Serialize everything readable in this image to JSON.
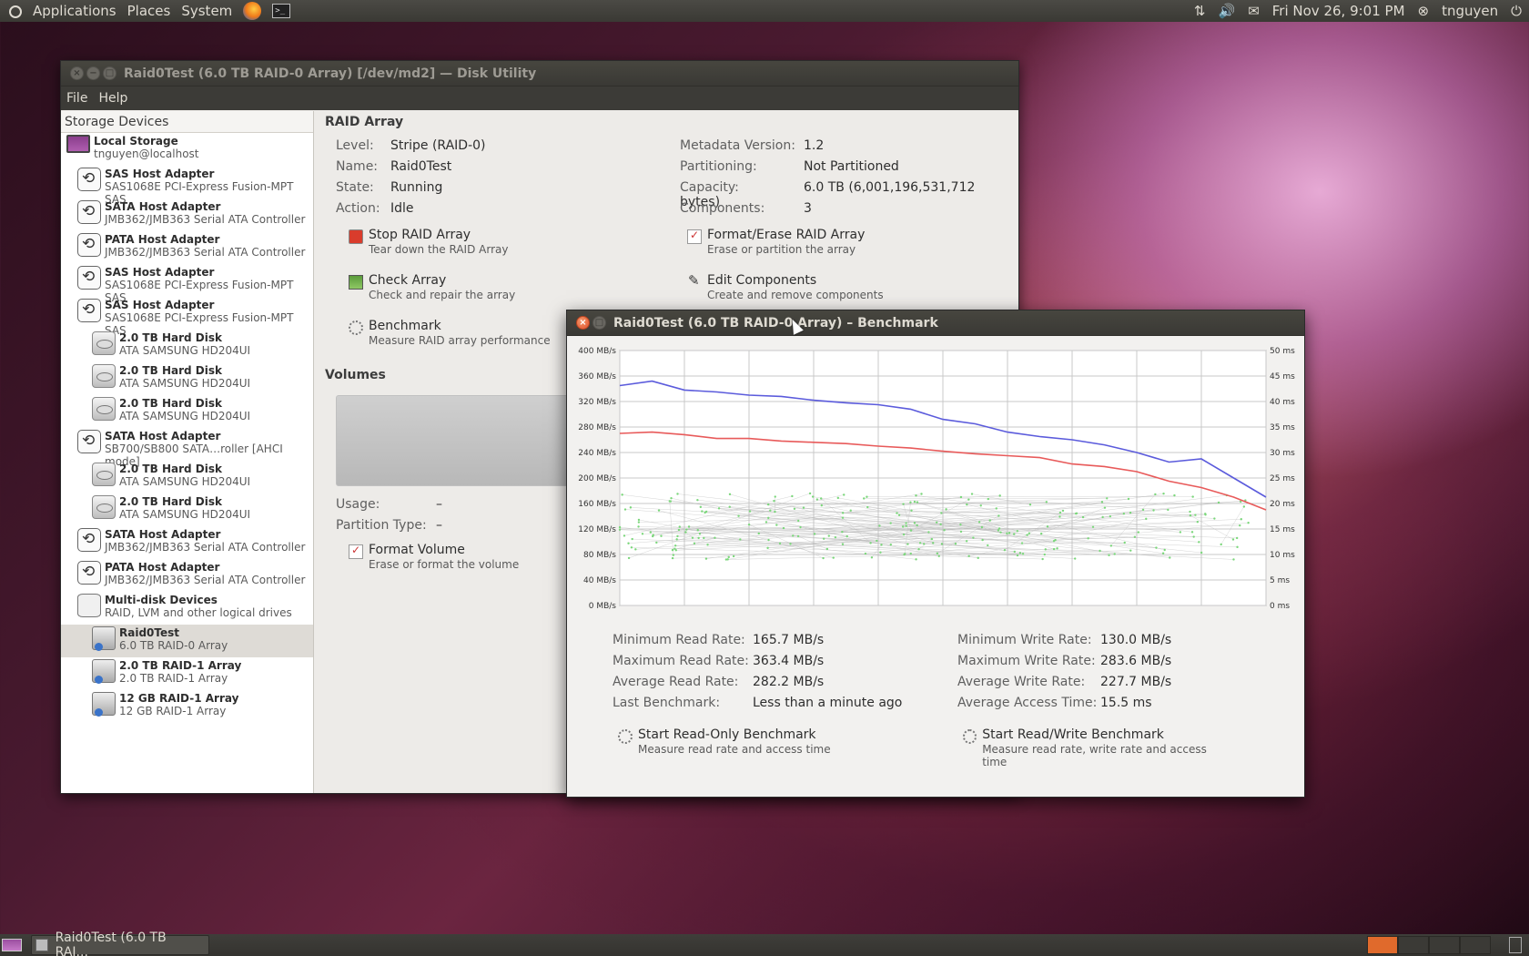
{
  "top_panel": {
    "menus": [
      "Applications",
      "Places",
      "System"
    ],
    "datetime": "Fri Nov 26,  9:01 PM",
    "user": "tnguyen"
  },
  "main_window": {
    "title": "Raid0Test (6.0 TB RAID-0 Array) [/dev/md2] — Disk Utility",
    "menu": [
      "File",
      "Help"
    ],
    "sidebar": {
      "header": "Storage Devices",
      "items": [
        {
          "title": "Local Storage",
          "sub": "tnguyen@localhost",
          "icon": "computer-icon"
        },
        {
          "title": "SAS Host Adapter",
          "sub": "SAS1068E PCI-Express Fusion-MPT SAS",
          "icon": "adapter-icon"
        },
        {
          "title": "SATA Host Adapter",
          "sub": "JMB362/JMB363 Serial ATA Controller",
          "icon": "adapter-icon"
        },
        {
          "title": "PATA Host Adapter",
          "sub": "JMB362/JMB363 Serial ATA Controller",
          "icon": "adapter-icon"
        },
        {
          "title": "SAS Host Adapter",
          "sub": "SAS1068E PCI-Express Fusion-MPT SAS",
          "icon": "adapter-icon"
        },
        {
          "title": "SAS Host Adapter",
          "sub": "SAS1068E PCI-Express Fusion-MPT SAS",
          "icon": "adapter-icon"
        },
        {
          "title": "2.0 TB Hard Disk",
          "sub": "ATA SAMSUNG HD204UI",
          "icon": "disk-icon"
        },
        {
          "title": "2.0 TB Hard Disk",
          "sub": "ATA SAMSUNG HD204UI",
          "icon": "disk-icon"
        },
        {
          "title": "2.0 TB Hard Disk",
          "sub": "ATA SAMSUNG HD204UI",
          "icon": "disk-icon"
        },
        {
          "title": "SATA Host Adapter",
          "sub": "SB700/SB800 SATA…roller [AHCI mode]",
          "icon": "adapter-icon"
        },
        {
          "title": "2.0 TB Hard Disk",
          "sub": "ATA SAMSUNG HD204UI",
          "icon": "disk-icon"
        },
        {
          "title": "2.0 TB Hard Disk",
          "sub": "ATA SAMSUNG HD204UI",
          "icon": "disk-icon"
        },
        {
          "title": "SATA Host Adapter",
          "sub": "JMB362/JMB363 Serial ATA Controller",
          "icon": "adapter-icon"
        },
        {
          "title": "PATA Host Adapter",
          "sub": "JMB362/JMB363 Serial ATA Controller",
          "icon": "adapter-icon"
        },
        {
          "title": "Multi-disk Devices",
          "sub": "RAID, LVM and other logical drives",
          "icon": "multi-disk-icon"
        },
        {
          "title": "Raid0Test",
          "sub": "6.0 TB RAID-0 Array",
          "icon": "raid-icon"
        },
        {
          "title": "2.0 TB RAID-1 Array",
          "sub": "2.0 TB RAID-1 Array",
          "icon": "raid-icon"
        },
        {
          "title": "12 GB RAID-1 Array",
          "sub": "12 GB RAID-1 Array",
          "icon": "raid-icon"
        }
      ],
      "selected": "Raid0Test"
    },
    "raid": {
      "section_title": "RAID Array",
      "fields_left": [
        {
          "k": "Level:",
          "v": "Stripe (RAID-0)"
        },
        {
          "k": "Name:",
          "v": "Raid0Test"
        },
        {
          "k": "State:",
          "v": "Running"
        },
        {
          "k": "Action:",
          "v": "Idle"
        }
      ],
      "fields_right": [
        {
          "k": "Metadata Version:",
          "v": "1.2"
        },
        {
          "k": "Partitioning:",
          "v": "Not Partitioned"
        },
        {
          "k": "Capacity:",
          "v": "6.0 TB (6,001,196,531,712 bytes)"
        },
        {
          "k": "Components:",
          "v": "3"
        }
      ],
      "actions": {
        "stop": {
          "title": "Stop RAID Array",
          "sub": "Tear down the RAID Array"
        },
        "format": {
          "title": "Format/Erase RAID Array",
          "sub": "Erase or partition the array"
        },
        "check": {
          "title": "Check Array",
          "sub": "Check and repair the array"
        },
        "edit": {
          "title": "Edit Components",
          "sub": "Create and remove components"
        },
        "benchmark": {
          "title": "Benchmark",
          "sub": "Measure RAID array performance"
        }
      }
    },
    "volumes": {
      "section_title": "Volumes",
      "usage_label": "Usage:",
      "usage_value": "–",
      "ptype_label": "Partition Type:",
      "ptype_value": "–",
      "format_title": "Format Volume",
      "format_sub": "Erase or format the volume"
    }
  },
  "bench_window": {
    "title": "Raid0Test (6.0 TB RAID-0 Array) – Benchmark",
    "stats_left": [
      {
        "k": "Minimum Read Rate:",
        "v": "165.7 MB/s"
      },
      {
        "k": "Maximum Read Rate:",
        "v": "363.4 MB/s"
      },
      {
        "k": "Average Read Rate:",
        "v": "282.2 MB/s"
      },
      {
        "k": "Last Benchmark:",
        "v": "Less than a minute ago"
      }
    ],
    "stats_right": [
      {
        "k": "Minimum Write Rate:",
        "v": "130.0 MB/s"
      },
      {
        "k": "Maximum Write Rate:",
        "v": "283.6 MB/s"
      },
      {
        "k": "Average Write Rate:",
        "v": "227.7 MB/s"
      },
      {
        "k": "Average Access Time:",
        "v": "15.5 ms"
      }
    ],
    "btn_readonly": {
      "title": "Start Read-Only Benchmark",
      "sub": "Measure read rate and access time"
    },
    "btn_readwrite": {
      "title": "Start Read/Write Benchmark",
      "sub": "Measure read rate, write rate and access time"
    }
  },
  "chart_data": {
    "type": "line",
    "title": "",
    "xlabel": "",
    "ylabel": "",
    "x_ticks": [
      "0%",
      "10%",
      "20%",
      "30%",
      "40%",
      "50%",
      "60%",
      "70%",
      "80%",
      "90%",
      "100%"
    ],
    "y_left_ticks": [
      "0 MB/s",
      "40 MB/s",
      "80 MB/s",
      "120 MB/s",
      "160 MB/s",
      "200 MB/s",
      "240 MB/s",
      "280 MB/s",
      "320 MB/s",
      "360 MB/s",
      "400 MB/s"
    ],
    "y_right_ticks": [
      "0 ms",
      "5 ms",
      "10 ms",
      "15 ms",
      "20 ms",
      "25 ms",
      "30 ms",
      "35 ms",
      "40 ms",
      "45 ms",
      "50 ms"
    ],
    "ylim_left": [
      0,
      400
    ],
    "ylim_right": [
      0,
      50
    ],
    "xlim": [
      0,
      100
    ],
    "grid": true,
    "series": [
      {
        "color": "#5b5bdc",
        "axis": "left",
        "x": [
          0,
          5,
          10,
          15,
          20,
          25,
          30,
          35,
          40,
          45,
          50,
          55,
          60,
          65,
          70,
          75,
          80,
          85,
          90,
          95,
          100
        ],
        "values": [
          345,
          352,
          338,
          335,
          330,
          328,
          322,
          318,
          315,
          308,
          292,
          285,
          272,
          265,
          260,
          252,
          240,
          225,
          230,
          200,
          170
        ]
      },
      {
        "color": "#e85a5a",
        "axis": "left",
        "x": [
          0,
          5,
          10,
          15,
          20,
          25,
          30,
          35,
          40,
          45,
          50,
          55,
          60,
          65,
          70,
          75,
          80,
          85,
          90,
          95,
          100
        ],
        "values": [
          270,
          272,
          268,
          262,
          262,
          258,
          256,
          254,
          250,
          247,
          242,
          238,
          235,
          232,
          222,
          218,
          210,
          195,
          185,
          170,
          150
        ]
      }
    ],
    "access_time_points": "scatter of green points, mostly 12–20 ms"
  },
  "bottom_panel": {
    "task_label": "Raid0Test (6.0 TB RAI..."
  }
}
